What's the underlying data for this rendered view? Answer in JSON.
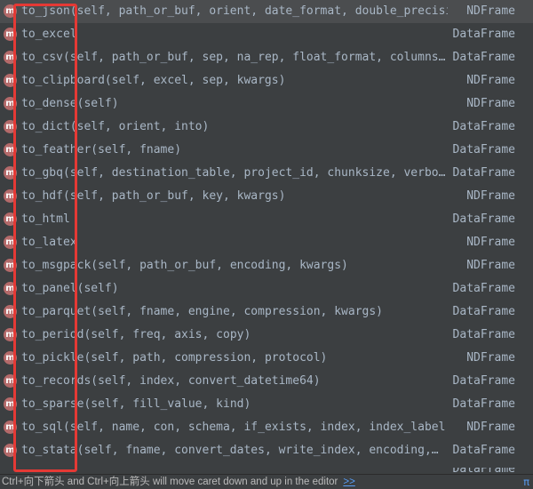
{
  "items": [
    {
      "name": "to_json",
      "params": "(self, path_or_buf, orient, date_format, double_precisi…",
      "ret": "NDFrame",
      "selected": true
    },
    {
      "name": "to_excel",
      "params": "",
      "ret": "DataFrame"
    },
    {
      "name": "to_csv",
      "params": "(self, path_or_buf, sep, na_rep, float_format, columns…",
      "ret": "DataFrame"
    },
    {
      "name": "to_clipboard",
      "params": "(self, excel, sep, kwargs)",
      "ret": "NDFrame"
    },
    {
      "name": "to_dense",
      "params": "(self)",
      "ret": "NDFrame"
    },
    {
      "name": "to_dict",
      "params": "(self, orient, into)",
      "ret": "DataFrame"
    },
    {
      "name": "to_feather",
      "params": "(self, fname)",
      "ret": "DataFrame"
    },
    {
      "name": "to_gbq",
      "params": "(self, destination_table, project_id, chunksize, verbo…",
      "ret": "DataFrame"
    },
    {
      "name": "to_hdf",
      "params": "(self, path_or_buf, key, kwargs)",
      "ret": "NDFrame"
    },
    {
      "name": "to_html",
      "params": "",
      "ret": "DataFrame"
    },
    {
      "name": "to_latex",
      "params": "",
      "ret": "NDFrame"
    },
    {
      "name": "to_msgpack",
      "params": "(self, path_or_buf, encoding, kwargs)",
      "ret": "NDFrame"
    },
    {
      "name": "to_panel",
      "params": "(self)",
      "ret": "DataFrame"
    },
    {
      "name": "to_parquet",
      "params": "(self, fname, engine, compression, kwargs)",
      "ret": "DataFrame"
    },
    {
      "name": "to_period",
      "params": "(self, freq, axis, copy)",
      "ret": "DataFrame"
    },
    {
      "name": "to_pickle",
      "params": "(self, path, compression, protocol)",
      "ret": "NDFrame"
    },
    {
      "name": "to_records",
      "params": "(self, index, convert_datetime64)",
      "ret": "DataFrame"
    },
    {
      "name": "to_sparse",
      "params": "(self, fill_value, kind)",
      "ret": "DataFrame"
    },
    {
      "name": "to_sql",
      "params": "(self, name, con, schema, if_exists, index, index_label,…",
      "ret": "NDFrame"
    },
    {
      "name": "to_stata",
      "params": "(self, fname, convert_dates, write_index, encoding,…",
      "ret": "DataFrame"
    }
  ],
  "icon_letter": "m",
  "footer": {
    "hint": "Ctrl+向下箭头 and Ctrl+向上箭头 will move caret down and up in the editor",
    "more": ">>",
    "pi": "π"
  },
  "colors": {
    "background": "#3c3f41",
    "text": "#a9b7c6",
    "selected_row": "#4b4d4f",
    "method_icon": "#b46a6a",
    "highlight": "#e53935",
    "link": "#589df6"
  }
}
